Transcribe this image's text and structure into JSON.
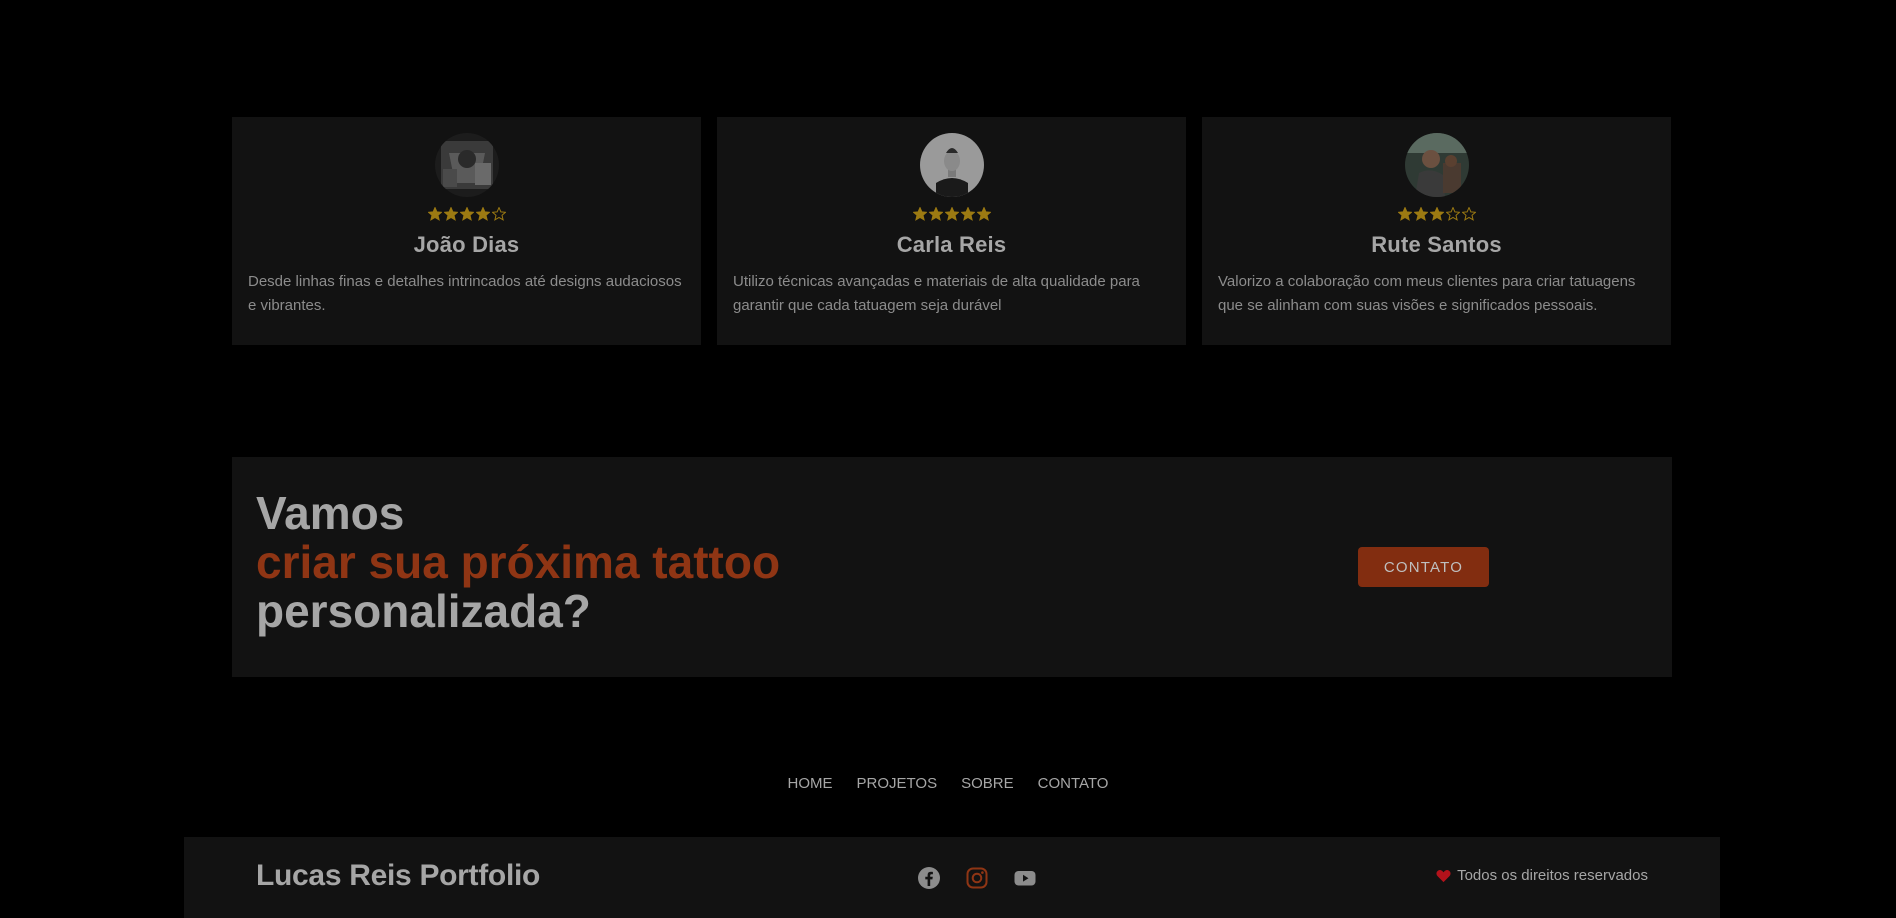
{
  "testimonials": [
    {
      "name": "João Dias",
      "rating": 4,
      "text": "Desde linhas finas e detalhes intrincados até designs audaciosos e vibrantes."
    },
    {
      "name": "Carla Reis",
      "rating": 5,
      "text": "Utilizo técnicas avançadas e materiais de alta qualidade para garantir que cada tatuagem seja durável"
    },
    {
      "name": "Rute Santos",
      "rating": 3,
      "text": "Valorizo a colaboração com meus clientes para criar tatuagens que se alinham com suas visões e significados pessoais."
    }
  ],
  "cta": {
    "line1": "Vamos",
    "line2": "criar sua próxima tattoo",
    "line3": "personalizada?",
    "button": "CONTATO"
  },
  "footer_nav": [
    "HOME",
    "PROJETOS",
    "SOBRE",
    "CONTATO"
  ],
  "footer": {
    "brand": "Lucas Reis Portfolio",
    "rights": "Todos os direitos reservados",
    "socials": [
      "facebook-icon",
      "instagram-icon",
      "youtube-icon"
    ]
  },
  "colors": {
    "accent": "#8f3514",
    "button": "#822d10",
    "star": "#9c7a12",
    "card": "#121212",
    "heart": "#b3121b"
  }
}
